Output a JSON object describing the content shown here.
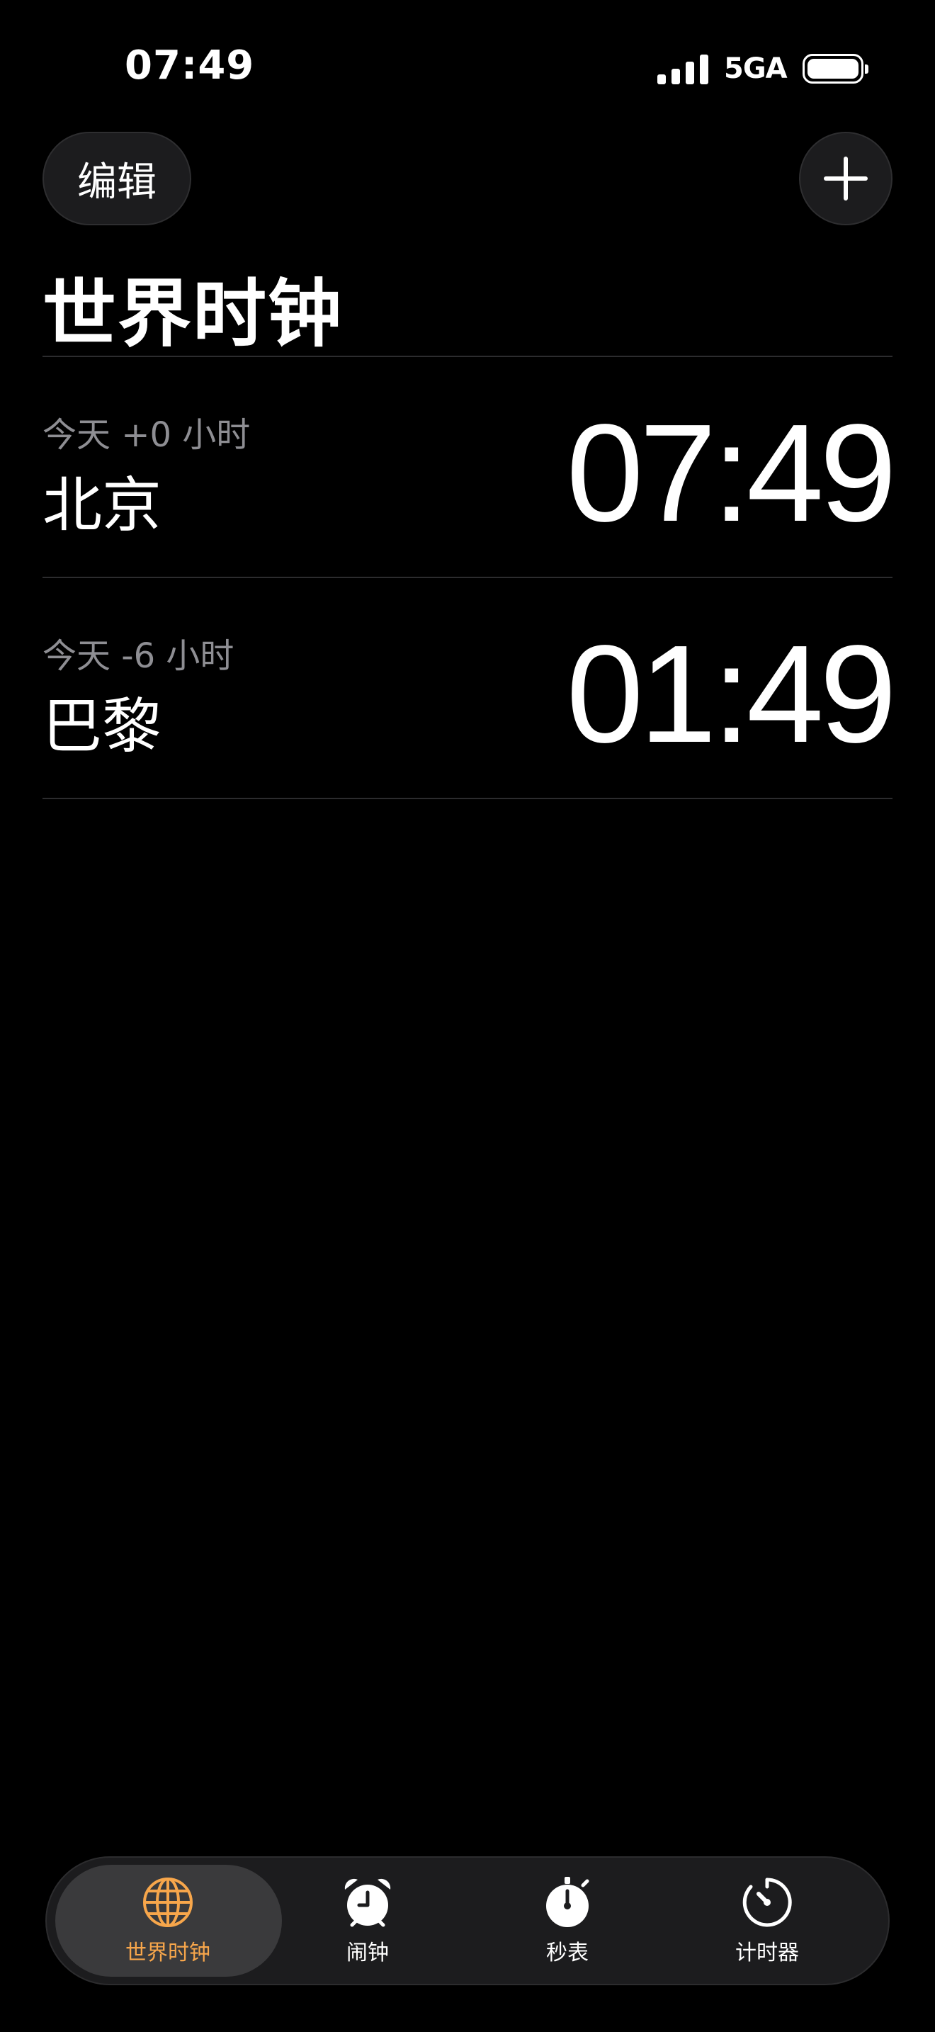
{
  "status_bar": {
    "time": "07:49",
    "network": "5GA"
  },
  "header": {
    "edit_label": "编辑",
    "title": "世界时钟"
  },
  "clocks": [
    {
      "offset": "今天 +0 小时",
      "city": "北京",
      "time": "07:49"
    },
    {
      "offset": "今天 -6 小时",
      "city": "巴黎",
      "time": "01:49"
    }
  ],
  "tabs": [
    {
      "label": "世界时钟",
      "icon": "globe-icon",
      "active": true
    },
    {
      "label": "闹钟",
      "icon": "alarm-clock-icon",
      "active": false
    },
    {
      "label": "秒表",
      "icon": "stopwatch-icon",
      "active": false
    },
    {
      "label": "计时器",
      "icon": "timer-icon",
      "active": false
    }
  ],
  "colors": {
    "background": "#000000",
    "accent": "#f7a64b",
    "secondary_text": "#8e8e93",
    "button_bg": "#1c1c1e"
  }
}
